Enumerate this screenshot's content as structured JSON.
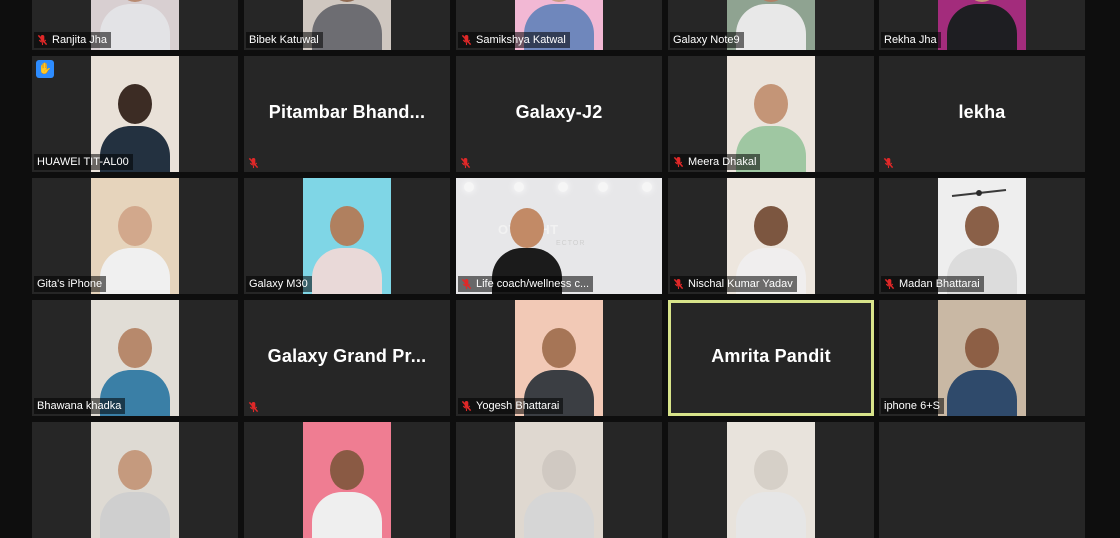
{
  "participants": [
    {
      "name": "Ranjita Jha",
      "muted": true,
      "video": true,
      "wall": "#d8cfd1",
      "skin": "#b88b72",
      "shirt": "#e3e3e6"
    },
    {
      "name": "Bibek Katuwal",
      "muted": false,
      "video": true,
      "wall": "#cfc7c0",
      "skin": "#8f6a52",
      "shirt": "#6d6d72"
    },
    {
      "name": "Samikshya Katwal",
      "muted": true,
      "video": true,
      "wall": "#f2b8d4",
      "skin": "#c99d84",
      "shirt": "#6f87bc"
    },
    {
      "name": "Galaxy Note9",
      "muted": false,
      "video": true,
      "wall": "#8fa391",
      "skin": "#b08066",
      "shirt": "#e8e8e8"
    },
    {
      "name": "Rekha Jha",
      "muted": false,
      "video": true,
      "wall": "#a32c7c",
      "skin": "#c4957a",
      "shirt": "#1e1e22"
    },
    {
      "name": "HUAWEI TIT-AL00",
      "muted": false,
      "video": true,
      "hand": true,
      "wall": "#e9e1d8",
      "skin": "#3c2c24",
      "shirt": "#233140"
    },
    {
      "name": "Pitambar  Bhand...",
      "muted": true,
      "video": false
    },
    {
      "name": "Galaxy-J2",
      "muted": true,
      "video": false
    },
    {
      "name": "Meera Dhakal",
      "muted": true,
      "video": true,
      "wall": "#ebe4dc",
      "skin": "#c49577",
      "shirt": "#9fc7a2"
    },
    {
      "name": "lekha",
      "muted": true,
      "video": false
    },
    {
      "name": "Gita's iPhone",
      "muted": false,
      "video": true,
      "wall": "#e6d4bc",
      "skin": "#d2a88c",
      "shirt": "#f0f0f0"
    },
    {
      "name": "Galaxy M30",
      "muted": false,
      "video": true,
      "wall": "#7fd6e6",
      "skin": "#b0805f",
      "shirt": "#e9d9d8"
    },
    {
      "name": "Life coach/wellness c...",
      "muted": true,
      "video": true,
      "spotlight": true,
      "wall": "#e7e7e9",
      "skin": "#c28a66",
      "shirt": "#1b1b1b"
    },
    {
      "name": "Nischal Kumar Yadav",
      "muted": true,
      "video": true,
      "wall": "#ede6de",
      "skin": "#7c5640",
      "shirt": "#f0eeee"
    },
    {
      "name": "Madan  Bhattarai",
      "muted": true,
      "video": true,
      "fan": true,
      "wall": "#eeeeee",
      "skin": "#8a6048",
      "shirt": "#dcdcdc"
    },
    {
      "name": "Bhawana khadka",
      "muted": false,
      "video": true,
      "wall": "#e1ddd6",
      "skin": "#b7896c",
      "shirt": "#3a7fa6"
    },
    {
      "name": "Galaxy Grand Pr...",
      "muted": true,
      "video": false
    },
    {
      "name": "Yogesh Bhattarai",
      "muted": true,
      "video": true,
      "wall": "#f2c9b6",
      "skin": "#a67556",
      "shirt": "#3b3e43"
    },
    {
      "name": "Amrita Pandit",
      "muted": false,
      "video": false,
      "active": true
    },
    {
      "name": "iphone 6+S",
      "muted": false,
      "video": true,
      "wall": "#c9b8a4",
      "skin": "#8d5f45",
      "shirt": "#2f4a6b"
    },
    {
      "name": "",
      "muted": false,
      "video": true,
      "wall": "#dedad3",
      "skin": "#c59a7e",
      "shirt": "#cfcfcf"
    },
    {
      "name": "",
      "muted": false,
      "video": true,
      "wall": "#ef7d92",
      "skin": "#8a5a44",
      "shirt": "#efefef"
    },
    {
      "name": "",
      "muted": false,
      "video": true,
      "wall": "#dfd8d0",
      "skin": "#d0c9c2",
      "shirt": "#d6d6d6"
    },
    {
      "name": "",
      "muted": false,
      "video": true,
      "wall": "#e8e3dc",
      "skin": "#d6d0c8",
      "shirt": "#e6e6e6"
    },
    {
      "name": "",
      "muted": false,
      "video": false
    }
  ],
  "spotlight": {
    "headline": "OTLIGHT",
    "sub": "ECTOR"
  },
  "colors": {
    "tile_bg": "#262626",
    "active_border": "#d8e48a",
    "mute_red": "#e02828",
    "hand_blue": "#2d8cff"
  },
  "icons": {
    "mute": "muted-microphone-icon",
    "hand": "raised-hand-icon"
  }
}
